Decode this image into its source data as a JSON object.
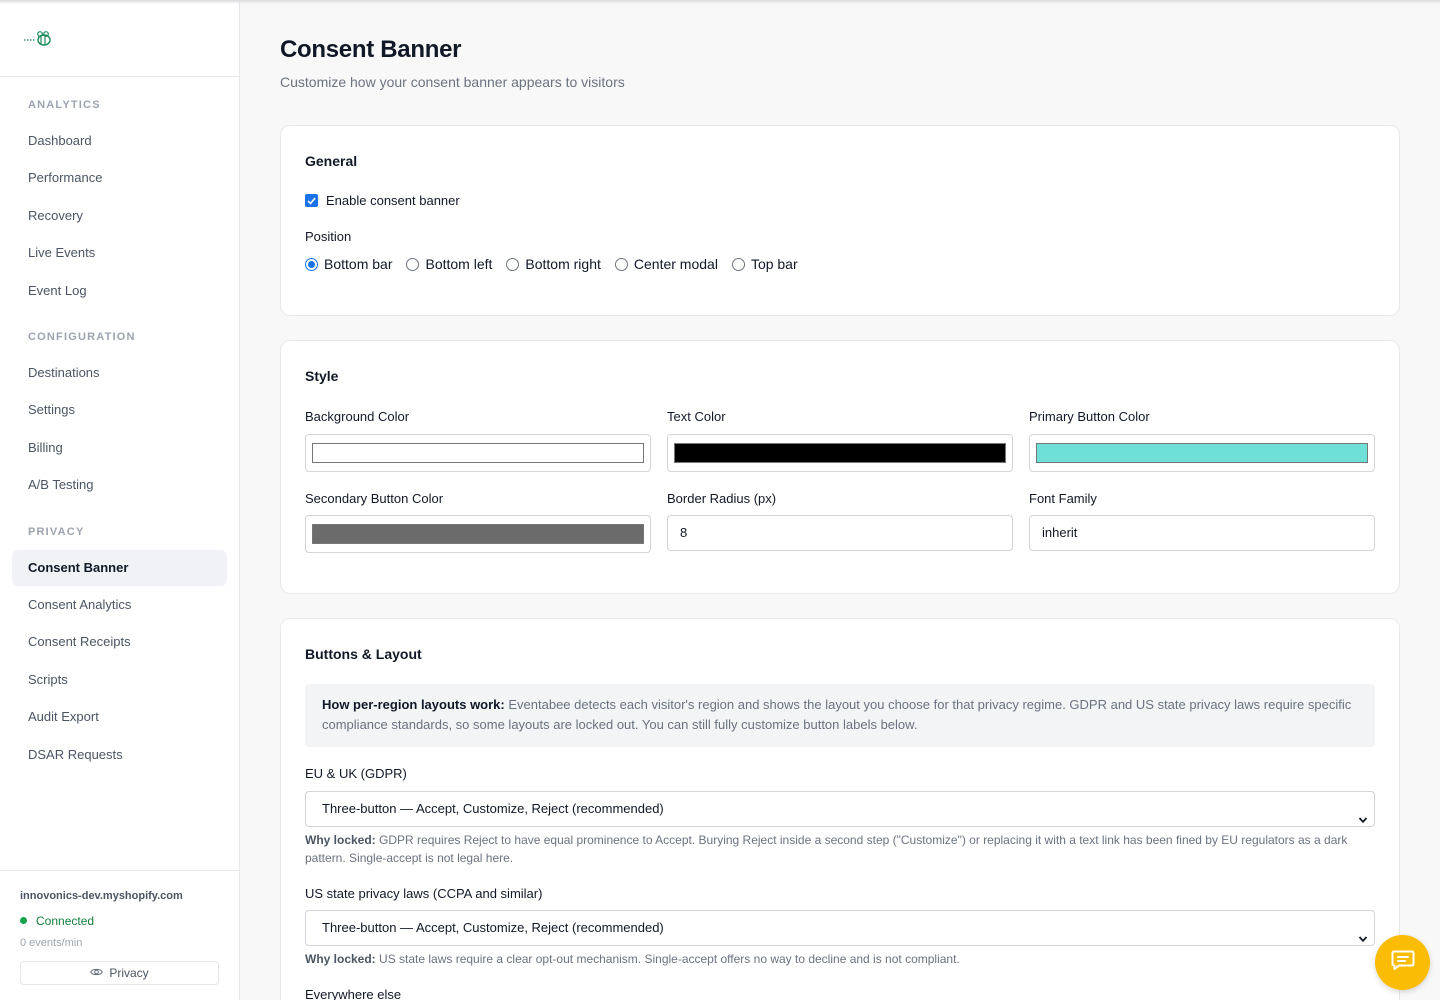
{
  "sidebar": {
    "logo_icon": "bee-logo-icon",
    "sections": [
      {
        "title": "ANALYTICS"
      },
      {
        "title": "CONFIGURATION"
      },
      {
        "title": "PRIVACY"
      }
    ],
    "analytics_items": [
      "Dashboard",
      "Performance",
      "Recovery",
      "Live Events",
      "Event Log"
    ],
    "configuration_items": [
      "Destinations",
      "Settings",
      "Billing",
      "A/B Testing"
    ],
    "privacy_items": [
      "Consent Banner",
      "Consent Analytics",
      "Consent Receipts",
      "Scripts",
      "Audit Export",
      "DSAR Requests"
    ],
    "active_item": "Consent Banner",
    "footer": {
      "shop": "innovonics-dev.myshopify.com",
      "status": "Connected",
      "rate": "0 events/min",
      "privacy_button": "Privacy"
    }
  },
  "header": {
    "title": "Consent Banner",
    "subtitle": "Customize how your consent banner appears to visitors"
  },
  "general": {
    "title": "General",
    "enable_label": "Enable consent banner",
    "enabled": true,
    "position_label": "Position",
    "positions": [
      "Bottom bar",
      "Bottom left",
      "Bottom right",
      "Center modal",
      "Top bar"
    ],
    "selected_position": "Bottom bar"
  },
  "style": {
    "title": "Style",
    "background_color_label": "Background Color",
    "background_color": "#ffffff",
    "text_color_label": "Text Color",
    "text_color": "#000000",
    "primary_button_color_label": "Primary Button Color",
    "primary_button_color": "#6ee0d8",
    "secondary_button_color_label": "Secondary Button Color",
    "secondary_button_color": "#6b6b6b",
    "border_radius_label": "Border Radius (px)",
    "border_radius": "8",
    "font_family_label": "Font Family",
    "font_family": "inherit"
  },
  "buttons_layout": {
    "title": "Buttons & Layout",
    "info_bold": "How per-region layouts work:",
    "info_text": " Eventabee detects each visitor's region and shows the layout you choose for that privacy regime. GDPR and US state privacy laws require specific compliance standards, so some layouts are locked out. You can still fully customize button labels below.",
    "eu_label": "EU & UK (GDPR)",
    "eu_value": "Three-button — Accept, Customize, Reject (recommended)",
    "eu_help_bold": "Why locked:",
    "eu_help_text": " GDPR requires Reject to have equal prominence to Accept. Burying Reject inside a second step (\"Customize\") or replacing it with a text link has been fined by EU regulators as a dark pattern. Single-accept is not legal here.",
    "us_label": "US state privacy laws (CCPA and similar)",
    "us_value": "Three-button — Accept, Customize, Reject (recommended)",
    "us_help_bold": "Why locked:",
    "us_help_text": " US state laws require a clear opt-out mechanism. Single-accept offers no way to decline and is not compliant.",
    "elsewhere_label": "Everywhere else"
  },
  "chat": {
    "icon": "chat-bubble-icon",
    "color": "#fbbc05"
  }
}
